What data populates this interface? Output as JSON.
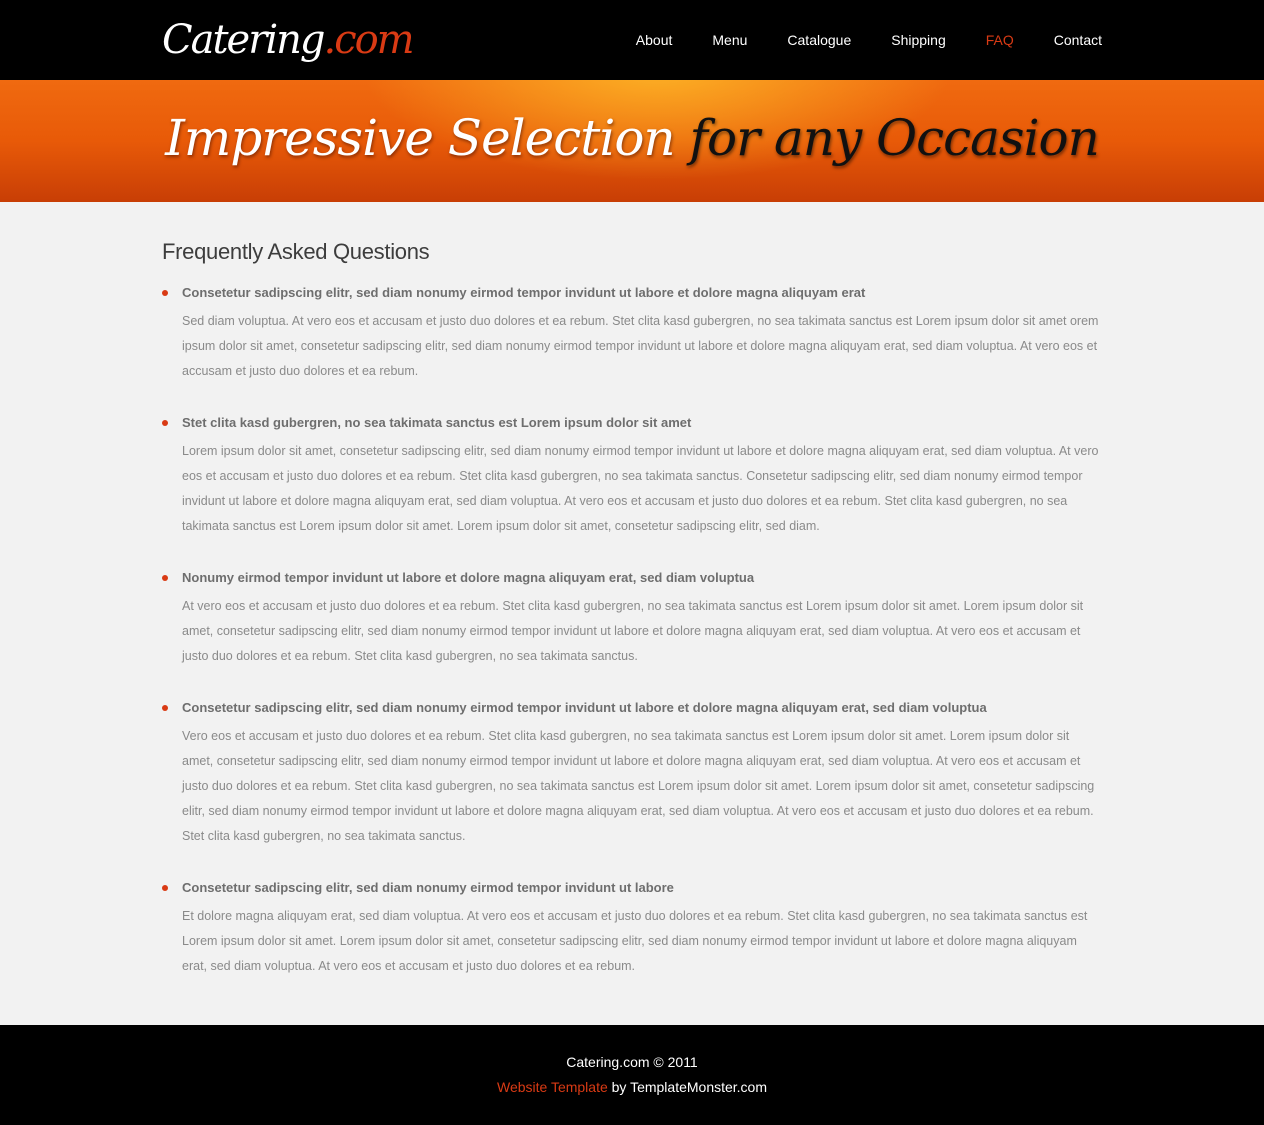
{
  "header": {
    "logo_main": "Catering",
    "logo_suffix": ".com",
    "nav": [
      {
        "label": "About"
      },
      {
        "label": "Menu"
      },
      {
        "label": "Catalogue"
      },
      {
        "label": "Shipping"
      },
      {
        "label": "FAQ",
        "active": true
      },
      {
        "label": "Contact"
      }
    ]
  },
  "banner": {
    "slogan_light": "Impressive Selection",
    "slogan_dark": "for any Occasion"
  },
  "main": {
    "title": "Frequently Asked Questions",
    "faq": [
      {
        "question": "Consetetur sadipscing elitr, sed diam nonumy eirmod tempor invidunt ut labore et dolore magna aliquyam erat",
        "answer": "Sed diam voluptua. At vero eos et accusam et justo duo dolores et ea rebum. Stet clita kasd gubergren, no sea takimata sanctus est Lorem ipsum dolor sit amet orem ipsum dolor sit amet, consetetur sadipscing elitr, sed diam nonumy eirmod tempor invidunt ut labore et dolore magna aliquyam erat, sed diam voluptua. At vero eos et accusam et justo duo dolores et ea rebum."
      },
      {
        "question": "Stet clita kasd gubergren, no sea takimata sanctus est Lorem ipsum dolor sit amet",
        "answer": "Lorem ipsum dolor sit amet, consetetur sadipscing elitr, sed diam nonumy eirmod tempor invidunt ut labore et dolore magna aliquyam erat, sed diam voluptua. At vero eos et accusam et justo duo dolores et ea rebum. Stet clita kasd gubergren, no sea takimata sanctus. Consetetur sadipscing elitr, sed diam nonumy eirmod tempor invidunt ut labore et dolore magna aliquyam erat, sed diam voluptua. At vero eos et accusam et justo duo dolores et ea rebum. Stet clita kasd gubergren, no sea takimata sanctus est Lorem ipsum dolor sit amet. Lorem ipsum dolor sit amet, consetetur sadipscing elitr, sed diam."
      },
      {
        "question": "Nonumy eirmod tempor invidunt ut labore et dolore magna aliquyam erat, sed diam voluptua",
        "answer": "At vero eos et accusam et justo duo dolores et ea rebum. Stet clita kasd gubergren, no sea takimata sanctus est Lorem ipsum dolor sit amet. Lorem ipsum dolor sit amet, consetetur sadipscing elitr, sed diam nonumy eirmod tempor invidunt ut labore et dolore magna aliquyam erat, sed diam voluptua. At vero eos et accusam et justo duo dolores et ea rebum. Stet clita kasd gubergren, no sea takimata sanctus."
      },
      {
        "question": "Consetetur sadipscing elitr, sed diam nonumy eirmod tempor invidunt ut labore et dolore magna aliquyam erat, sed diam voluptua",
        "answer": "Vero eos et accusam et justo duo dolores et ea rebum. Stet clita kasd gubergren, no sea takimata sanctus est Lorem ipsum dolor sit amet. Lorem ipsum dolor sit amet, consetetur sadipscing elitr, sed diam nonumy eirmod tempor invidunt ut labore et dolore magna aliquyam erat, sed diam voluptua. At vero eos et accusam et justo duo dolores et ea rebum. Stet clita kasd gubergren, no sea takimata sanctus est Lorem ipsum dolor sit amet. Lorem ipsum dolor sit amet, consetetur sadipscing elitr, sed diam nonumy eirmod tempor invidunt ut labore et dolore magna aliquyam erat, sed diam voluptua. At vero eos et accusam et justo duo dolores et ea rebum. Stet clita kasd gubergren, no sea takimata sanctus."
      },
      {
        "question": "Consetetur sadipscing elitr, sed diam nonumy eirmod tempor invidunt ut labore",
        "answer": "Et dolore magna aliquyam erat, sed diam voluptua. At vero eos et accusam et justo duo dolores et ea rebum. Stet clita kasd gubergren, no sea takimata sanctus est Lorem ipsum dolor sit amet. Lorem ipsum dolor sit amet, consetetur sadipscing elitr, sed diam nonumy eirmod tempor invidunt ut labore et dolore magna aliquyam erat, sed diam voluptua. At vero eos et accusam et justo duo dolores et ea rebum."
      }
    ]
  },
  "footer": {
    "copyright": "Catering.com © 2011",
    "template_link": "Website Template",
    "by_text": "by TemplateMonster.com"
  },
  "colors": {
    "accent": "#d93a14",
    "header_bg": "#000000",
    "page_bg": "#f2f2f2",
    "banner_orange": "#e85a08"
  }
}
